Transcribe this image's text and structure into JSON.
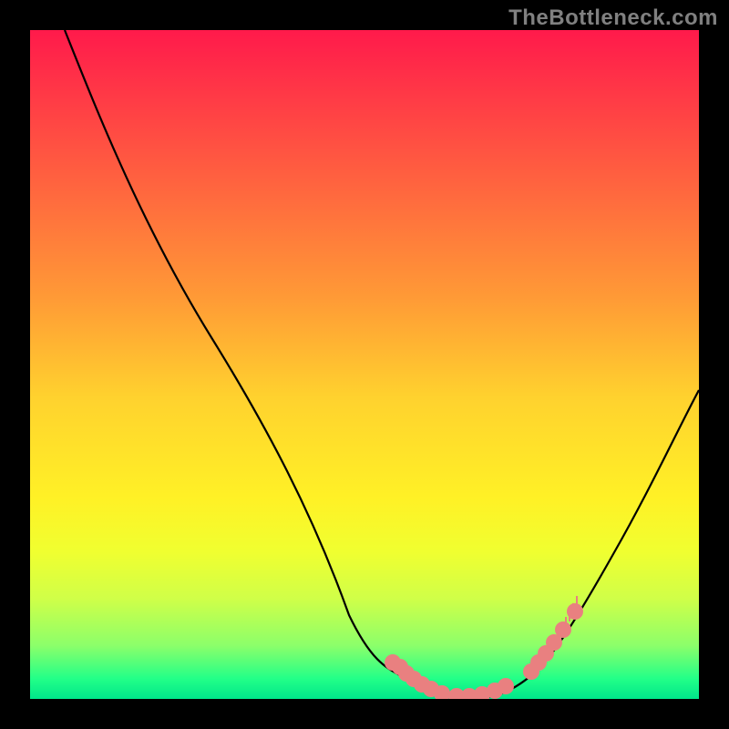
{
  "watermark": "TheBottleneck.com",
  "chart_data": {
    "type": "line",
    "title": "",
    "xlabel": "",
    "ylabel": "",
    "xlim": [
      0,
      734
    ],
    "ylim": [
      0,
      734
    ],
    "series": [
      {
        "name": "bottleneck-curve",
        "x": [
          38,
          100,
          200,
          300,
          350,
          395,
          420,
          450,
          480,
          510,
          540,
          565,
          600,
          650,
          700,
          734
        ],
        "y": [
          734,
          608,
          395,
          180,
          92,
          33,
          18,
          5,
          2,
          5,
          18,
          36,
          80,
          175,
          288,
          372
        ],
        "color": "#000000"
      }
    ],
    "markers": [
      {
        "name": "left-cluster",
        "type": "scatter",
        "x": [
          398,
          406,
          413,
          421,
          430,
          440,
          452,
          468,
          482,
          496,
          510,
          522
        ],
        "y": [
          40,
          35,
          28,
          22,
          16,
          11,
          6,
          3,
          3,
          5,
          9,
          14
        ],
        "color": "#e98080",
        "size": 9
      },
      {
        "name": "right-cluster",
        "type": "scatter",
        "x": [
          550,
          558,
          566,
          575,
          585,
          598
        ],
        "y": [
          30,
          40,
          50,
          62,
          76,
          96
        ],
        "color": "#e98080",
        "size": 9
      }
    ],
    "ticks": {
      "right_cluster_ticks_x": [
        548,
        552,
        556,
        560,
        564,
        568,
        572,
        576,
        580,
        584,
        588,
        592,
        596,
        600,
        604,
        608
      ],
      "right_cluster_ticks_y": [
        28,
        33,
        38,
        43,
        49,
        55,
        61,
        68,
        75,
        82,
        90,
        98,
        106,
        114,
        122,
        130
      ],
      "color": "#e98080"
    }
  }
}
